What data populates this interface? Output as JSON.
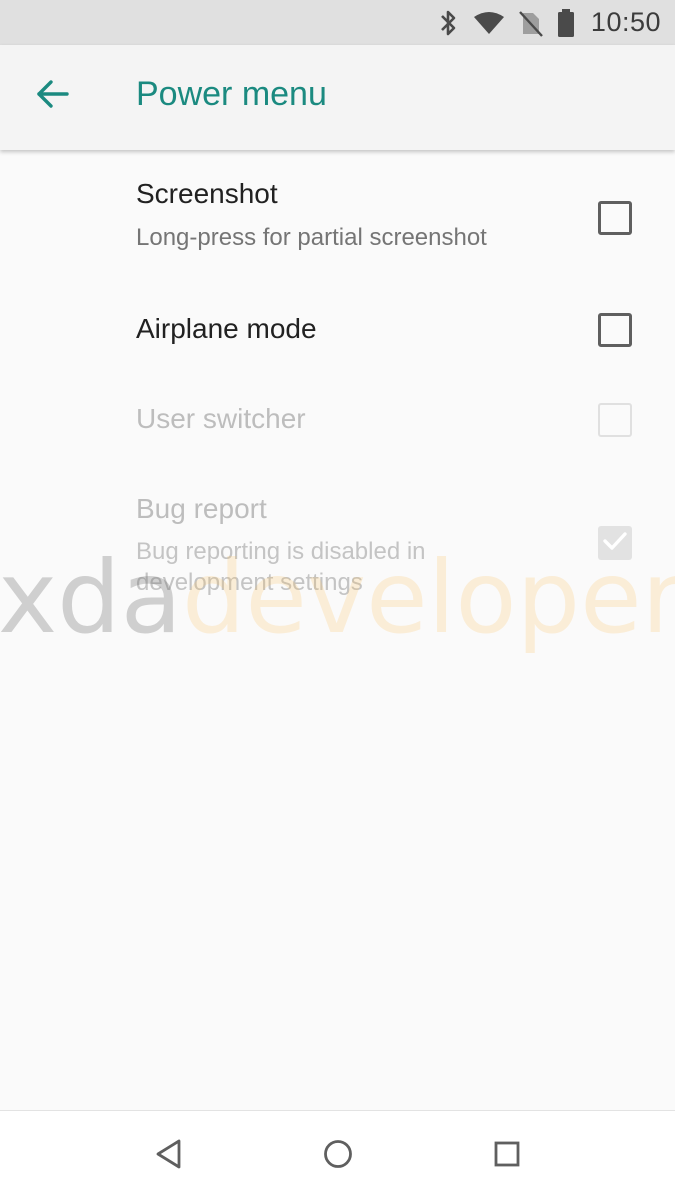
{
  "status_bar": {
    "time": "10:50",
    "icons": [
      "bluetooth-icon",
      "wifi-icon",
      "no-sim-icon",
      "battery-icon"
    ]
  },
  "app_bar": {
    "title": "Power menu",
    "back_icon": "arrow-back-icon",
    "accent_color": "#1b8a80"
  },
  "preferences": [
    {
      "title": "Screenshot",
      "summary": "Long-press for partial screenshot",
      "checked": false,
      "enabled": true
    },
    {
      "title": "Airplane mode",
      "summary": "",
      "checked": false,
      "enabled": true
    },
    {
      "title": "User switcher",
      "summary": "",
      "checked": false,
      "enabled": false
    },
    {
      "title": "Bug report",
      "summary": "Bug reporting is disabled in development settings",
      "checked": true,
      "enabled": false
    }
  ],
  "watermark": {
    "brand": "xda",
    "suffix": "developers"
  },
  "nav_bar": {
    "icons": [
      "back-triangle-icon",
      "home-circle-icon",
      "recents-square-icon"
    ]
  }
}
